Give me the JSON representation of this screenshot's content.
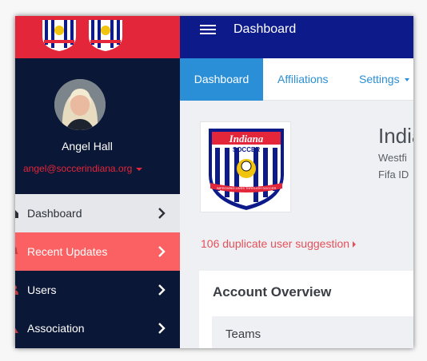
{
  "sidebar": {
    "profile": {
      "name": "Angel Hall",
      "email": "angel@soccerindiana.org"
    },
    "nav": [
      {
        "label": "Dashboard",
        "icon": "home-icon"
      },
      {
        "label": "Recent Updates",
        "icon": "bell-icon"
      },
      {
        "label": "Users",
        "icon": "users-icon"
      },
      {
        "label": "Association",
        "icon": "building-icon"
      }
    ]
  },
  "topbar": {
    "title": "Dashboard"
  },
  "tabs": {
    "dashboard": "Dashboard",
    "affiliations": "Affiliations",
    "settings": "Settings"
  },
  "org": {
    "crest_top_text": "Indiana",
    "crest_mid_text": "SOCCER",
    "crest_ribbon_text": "IMPROVING LIVES THROUGH SOCCER",
    "name": "India",
    "location": "Westfi",
    "fifa": "Fifa ID"
  },
  "duplicate": {
    "text": "106 duplicate user suggestion"
  },
  "overview": {
    "title": "Account Overview",
    "teams_label": "Teams"
  },
  "colors": {
    "sidebar_bg": "#0b1736",
    "logo_bar": "#e4263a",
    "topbar": "#0d1a8a",
    "active_tab": "#2a8fd6",
    "recent_updates_bg": "#fb6162",
    "link_red": "#e4505a"
  }
}
